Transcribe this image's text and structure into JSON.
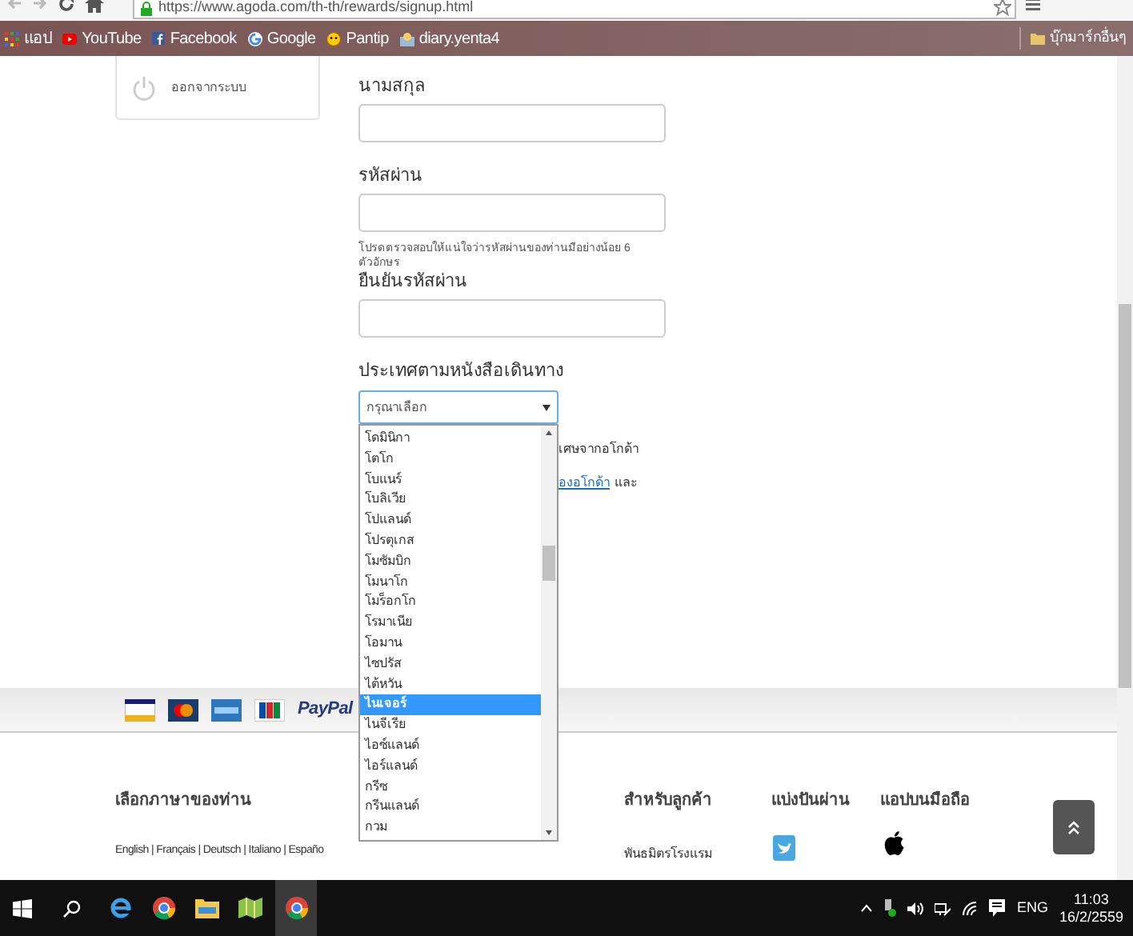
{
  "browser": {
    "url": "https://www.agoda.com/th-th/rewards/signup.html",
    "bookmarks": [
      {
        "label": "แอป",
        "kind": "apps"
      },
      {
        "label": "YouTube",
        "kind": "youtube"
      },
      {
        "label": "Facebook",
        "kind": "facebook"
      },
      {
        "label": "Google",
        "kind": "google"
      },
      {
        "label": "Pantip",
        "kind": "pantip"
      },
      {
        "label": "diary.yenta4",
        "kind": "site"
      }
    ],
    "other_bookmarks": "บุ๊กมาร์กอื่นๆ"
  },
  "sidebar": {
    "logout": "ออกจากระบบ"
  },
  "form": {
    "fields": [
      {
        "label": "นามสกุล"
      },
      {
        "label": "รหัสผ่าน",
        "hint": "โปรดตรวจสอบให้แน่ใจว่ารหัสผ่านของท่านมีอย่างน้อย 6 ตัวอักษร"
      },
      {
        "label": "ยืนยันรหัสผ่าน"
      }
    ],
    "country": {
      "label": "ประเทศตามหนังสือเดินทาง",
      "placeholder": "กรุณาเลือก",
      "options": [
        {
          "label": "โดมินิกา",
          "selected": false
        },
        {
          "label": "โตโก",
          "selected": false
        },
        {
          "label": "โบแนร์",
          "selected": false
        },
        {
          "label": "โบลิเวีย",
          "selected": false
        },
        {
          "label": "โปแลนด์",
          "selected": false
        },
        {
          "label": "โปรตุเกส",
          "selected": false
        },
        {
          "label": "โมซัมบิก",
          "selected": false
        },
        {
          "label": "โมนาโก",
          "selected": false
        },
        {
          "label": "โมร็อกโก",
          "selected": false
        },
        {
          "label": "โรมาเนีย",
          "selected": false
        },
        {
          "label": "โอมาน",
          "selected": false
        },
        {
          "label": "ไซปรัส",
          "selected": false
        },
        {
          "label": "ไต้หวัน",
          "selected": false
        },
        {
          "label": "ไนเจอร์",
          "selected": true
        },
        {
          "label": "ไนจีเรีย",
          "selected": false
        },
        {
          "label": "ไอซ์แลนด์",
          "selected": false
        },
        {
          "label": "ไอร์แลนด์",
          "selected": false
        },
        {
          "label": "กรีซ",
          "selected": false
        },
        {
          "label": "กรีนแลนด์",
          "selected": false
        },
        {
          "label": "กวม",
          "selected": false
        }
      ]
    },
    "behind_text": "เศษจากอโกด้า",
    "behind_link": "องอโกด้า",
    "behind_suffix": "และ"
  },
  "payments": {
    "paypal": "PayPal"
  },
  "footer": {
    "language_heading": "เลือกภาษาของท่าน",
    "languages": "English | Français | Deutsch | Italiano | Españo",
    "customers_heading": "สำหรับลูกค้า",
    "customers_link": "พันธมิตรโรงแรม",
    "share_heading": "แบ่งปันผ่าน",
    "apps_heading": "แอปบนมือถือ"
  },
  "taskbar": {
    "language": "ENG",
    "time": "11:03",
    "date": "16/2/2559"
  }
}
